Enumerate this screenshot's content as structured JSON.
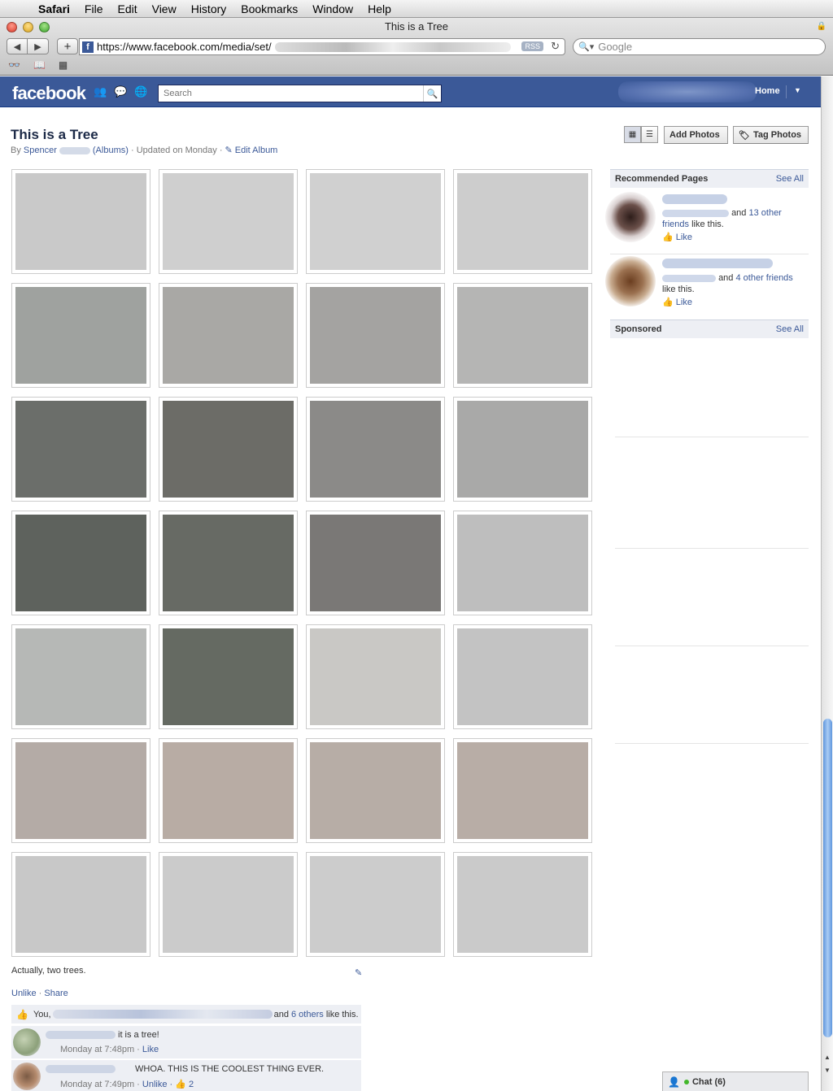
{
  "menubar": {
    "app": "Safari",
    "items": [
      "File",
      "Edit",
      "View",
      "History",
      "Bookmarks",
      "Window",
      "Help"
    ]
  },
  "browser": {
    "window_title": "This is a Tree",
    "url": "https://www.facebook.com/media/set/",
    "rss_label": "RSS",
    "search_placeholder": "Google"
  },
  "fb_header": {
    "logo": "facebook",
    "search_placeholder": "Search",
    "home_label": "Home"
  },
  "album": {
    "title": "This is a Tree",
    "by_label": "By",
    "author": "Spencer",
    "albums_link": "(Albums)",
    "updated": "· Updated on Monday ·",
    "edit_label": "Edit Album",
    "buttons": {
      "add_photos": "Add Photos",
      "tag_photos": "Tag Photos"
    },
    "photo_tones": [
      [
        "#c9c9c9",
        "#cfcfcf",
        "#d0d0d0",
        "#cdcdcd"
      ],
      [
        "#9fa29f",
        "#a9a8a5",
        "#a4a3a1",
        "#b5b5b4"
      ],
      [
        "#6b6e6a",
        "#6c6c67",
        "#8b8a88",
        "#a9a9a8"
      ],
      [
        "#5e625d",
        "#676a64",
        "#7a7876",
        "#bebebe"
      ],
      [
        "#b6b8b6",
        "#656a62",
        "#c9c8c5",
        "#c3c3c3"
      ],
      [
        "#b4aba6",
        "#b8aca4",
        "#b7ada6",
        "#b8ada6"
      ],
      [
        "#c8c8c8",
        "#cbcbcb",
        "#cccccc",
        "#cacaca"
      ]
    ]
  },
  "photo_caption": "Actually, two trees.",
  "actions": {
    "unlike": "Unlike",
    "separator": "·",
    "share": "Share"
  },
  "likes": {
    "you": "You,",
    "and_text": "and",
    "others_link": "6 others",
    "suffix": "like this."
  },
  "comments": [
    {
      "text": "it is a tree!",
      "time": "Monday at 7:48pm ·",
      "action": "Like",
      "extra": ""
    },
    {
      "text": "WHOA. THIS IS THE COOLEST THING EVER.",
      "time": "Monday at 7:49pm ·",
      "action": "Unlike",
      "extra": "· 👍 2"
    }
  ],
  "sidebar": {
    "recommended_title": "Recommended Pages",
    "see_all": "See All",
    "rec": [
      {
        "and_text": "and",
        "friends_link": "13 other friends",
        "suffix": "like this.",
        "like": "Like"
      },
      {
        "and_text": "and",
        "friends_link": "4 other friends",
        "suffix": "like this.",
        "like": "Like"
      }
    ],
    "sponsored_title": "Sponsored",
    "sponsored_see_all": "See All"
  },
  "chat": {
    "label": "Chat (6)"
  },
  "colors": {
    "fb_blue": "#3b5998",
    "link": "#3b5998",
    "header_bg": "#edeff4"
  }
}
